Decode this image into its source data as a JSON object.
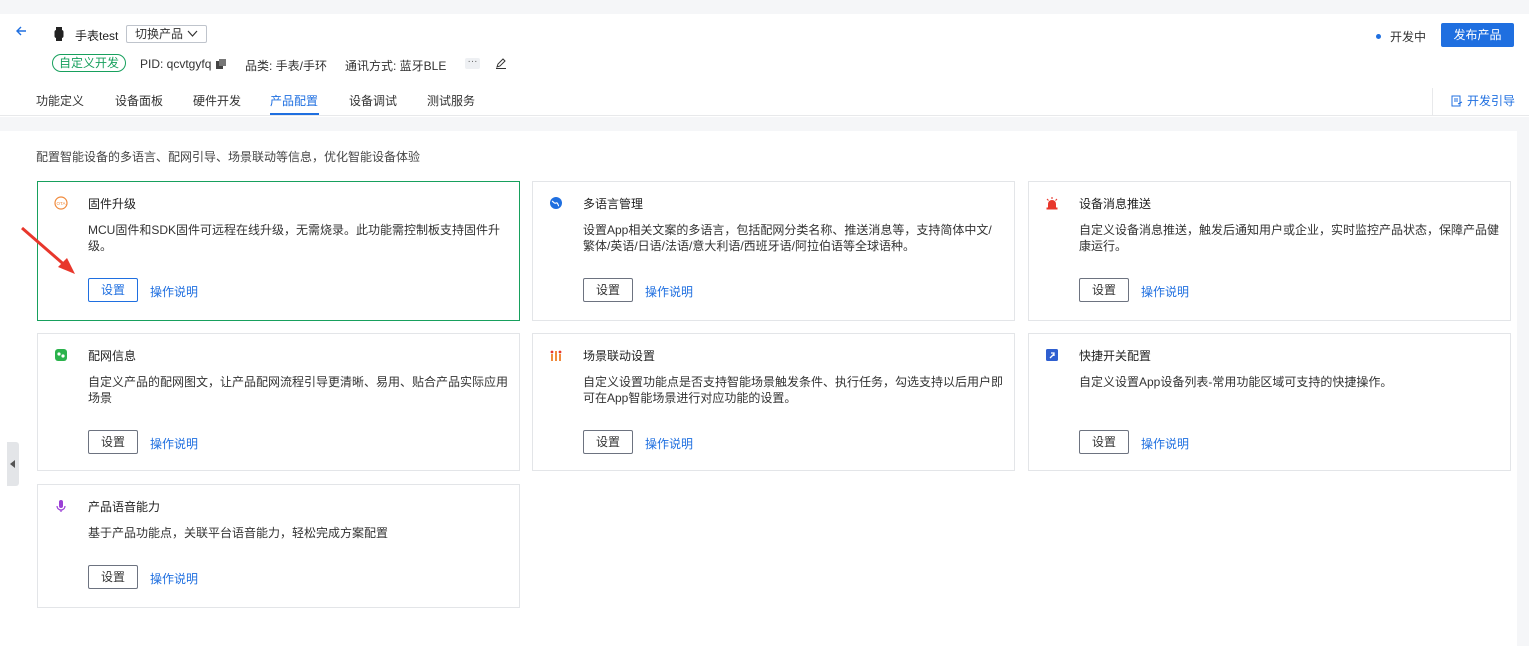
{
  "header": {
    "product_name": "手表test",
    "switch_product": "切换产品",
    "status": "开发中",
    "publish": "发布产品",
    "tag": "自定义开发",
    "pid": "PID: qcvtgyfq",
    "category": "品类: 手表/手环",
    "comm": "通讯方式: 蓝牙BLE"
  },
  "tabs": [
    "功能定义",
    "设备面板",
    "硬件开发",
    "产品配置",
    "设备调试",
    "测试服务"
  ],
  "active_tab": "产品配置",
  "guide": "开发引导",
  "description": "配置智能设备的多语言、配网引导、场景联动等信息，优化智能设备体验",
  "cards": [
    {
      "title": "固件升级",
      "text": "MCU固件和SDK固件可远程在线升级，无需烧录。此功能需控制板支持固件升级。",
      "set": "设置",
      "howto": "操作说明",
      "icon": "ota-icon"
    },
    {
      "title": "多语言管理",
      "text": "设置App相关文案的多语言，包括配网分类名称、推送消息等，支持简体中文/繁体/英语/日语/法语/意大利语/西班牙语/阿拉伯语等全球语种。",
      "set": "设置",
      "howto": "操作说明",
      "icon": "globe-icon"
    },
    {
      "title": "设备消息推送",
      "text": "自定义设备消息推送，触发后通知用户或企业，实时监控产品状态，保障产品健康运行。",
      "set": "设置",
      "howto": "操作说明",
      "icon": "alarm-icon"
    },
    {
      "title": "配网信息",
      "text": "自定义产品的配网图文，让产品配网流程引导更清晰、易用、贴合产品实际应用场景",
      "set": "设置",
      "howto": "操作说明",
      "icon": "network-icon"
    },
    {
      "title": "场景联动设置",
      "text": "自定义设置功能点是否支持智能场景触发条件、执行任务，勾选支持以后用户即可在App智能场景进行对应功能的设置。",
      "set": "设置",
      "howto": "操作说明",
      "icon": "scene-icon"
    },
    {
      "title": "快捷开关配置",
      "text": "自定义设置App设备列表-常用功能区域可支持的快捷操作。",
      "set": "设置",
      "howto": "操作说明",
      "icon": "shortcut-icon"
    },
    {
      "title": "产品语音能力",
      "text": "基于产品功能点，关联平台语音能力，轻松完成方案配置",
      "set": "设置",
      "howto": "操作说明",
      "icon": "microphone-icon"
    }
  ],
  "colors": {
    "primary": "#1f6fe0",
    "green": "#17a05d",
    "annotation": "#e8372c"
  }
}
